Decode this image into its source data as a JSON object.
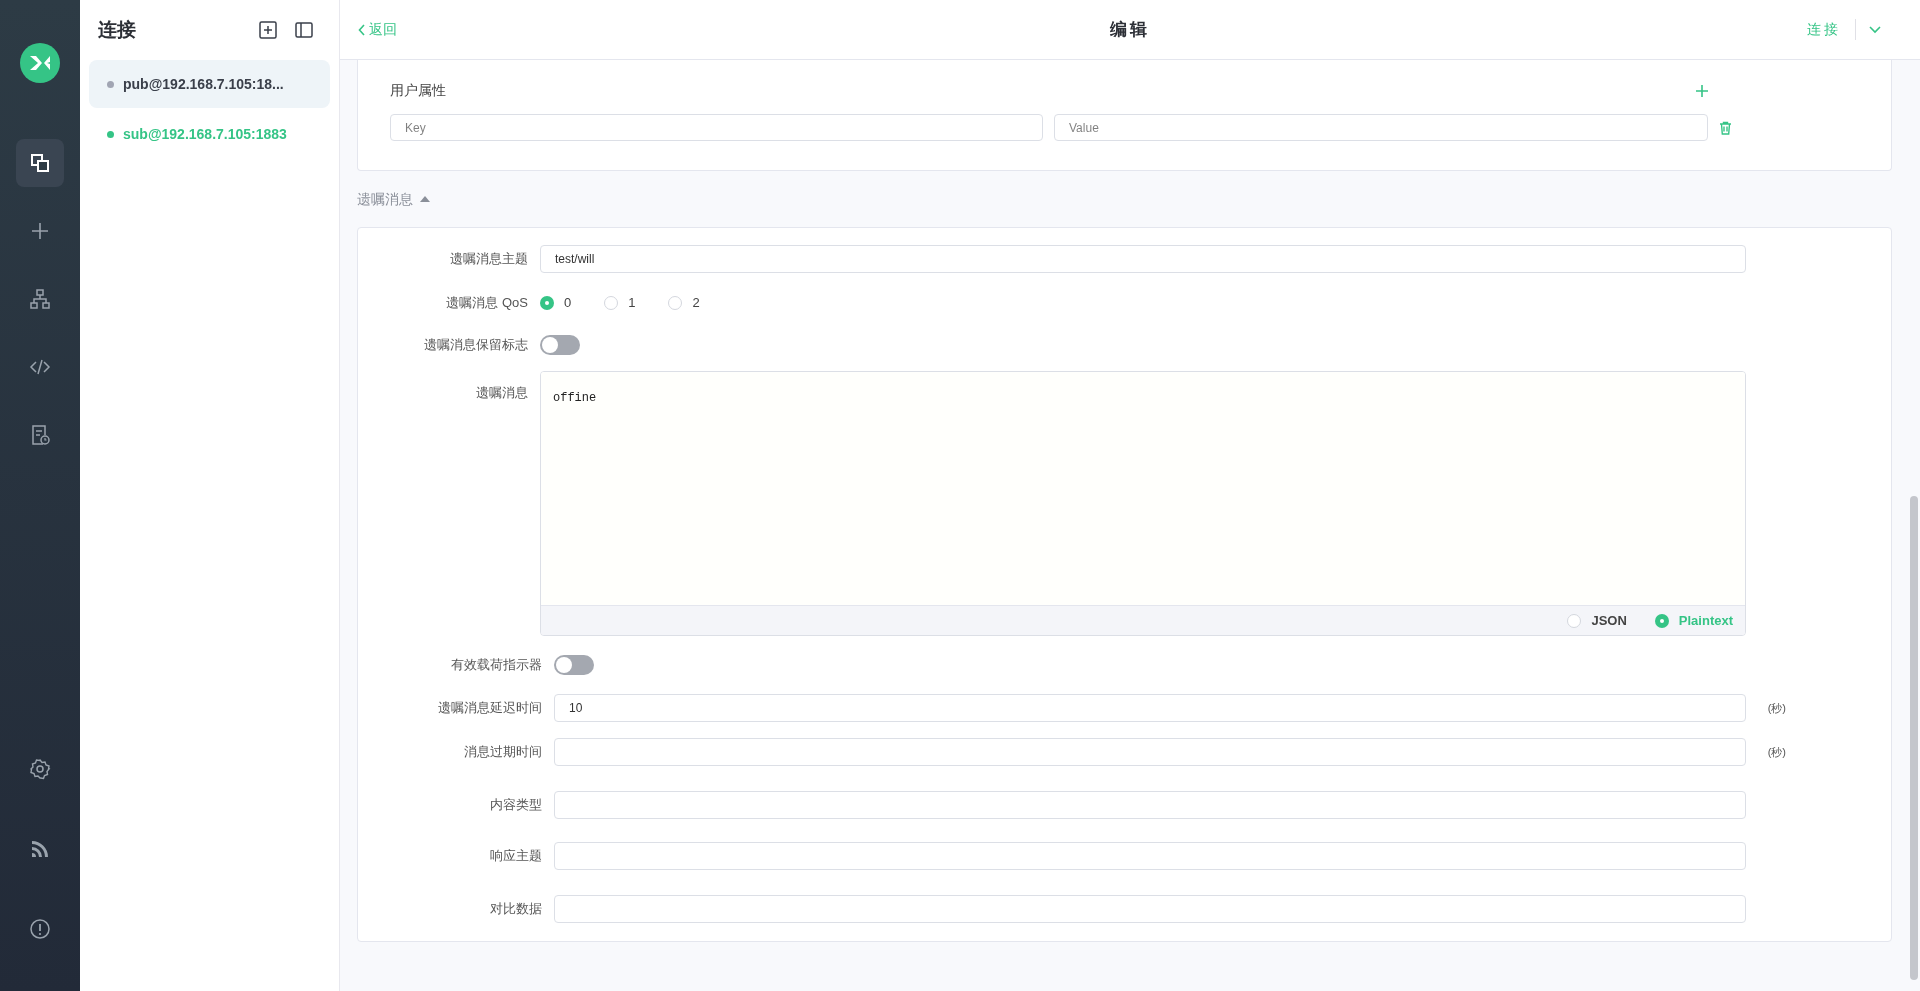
{
  "nav": {
    "items": [
      {
        "selected": true
      },
      {
        "selected": false
      },
      {
        "selected": false
      },
      {
        "selected": false
      },
      {
        "selected": false
      }
    ],
    "bottom_items": [
      {
        "selected": false
      },
      {
        "selected": false
      },
      {
        "selected": false
      }
    ]
  },
  "connections": {
    "title": "连接",
    "items": [
      {
        "name": "pub@192.168.7.105:18...",
        "connected": false,
        "selected": true
      },
      {
        "name": "sub@192.168.7.105:1883",
        "connected": true,
        "selected": false
      }
    ]
  },
  "header": {
    "back": "返回",
    "title": "编辑",
    "connect": "连接"
  },
  "user_properties": {
    "title": "用户属性",
    "rows": [
      {
        "key_placeholder": "Key",
        "value_placeholder": "Value"
      }
    ]
  },
  "will": {
    "title": "遗嘱消息",
    "expanded": true,
    "message": [
      {
        "kind": "input",
        "label": "遗嘱消息主题",
        "value": "test/will"
      },
      {
        "kind": "radio",
        "label": "遗嘱消息 QoS",
        "options": [
          {
            "label": "0",
            "selected": true
          },
          {
            "label": "1",
            "selected": false
          },
          {
            "label": "2",
            "selected": false
          }
        ]
      },
      {
        "kind": "switch",
        "label": "遗嘱消息保留标志",
        "on": false
      },
      {
        "kind": "editor",
        "label": "遗嘱消息",
        "value": "offine",
        "formats": [
          {
            "label": "JSON",
            "selected": false
          },
          {
            "label": "Plaintext",
            "selected": true
          }
        ]
      }
    ],
    "properties": [
      {
        "kind": "switch",
        "label": "有效载荷指示器",
        "on": false
      },
      {
        "kind": "input",
        "label": "遗嘱消息延迟时间",
        "value": "10",
        "unit": "(秒)"
      },
      {
        "kind": "input",
        "label": "消息过期时间",
        "unit": "(秒)"
      },
      {
        "kind": "input",
        "label": "内容类型"
      },
      {
        "kind": "input",
        "label": "响应主题"
      },
      {
        "kind": "input",
        "label": "对比数据"
      }
    ]
  }
}
